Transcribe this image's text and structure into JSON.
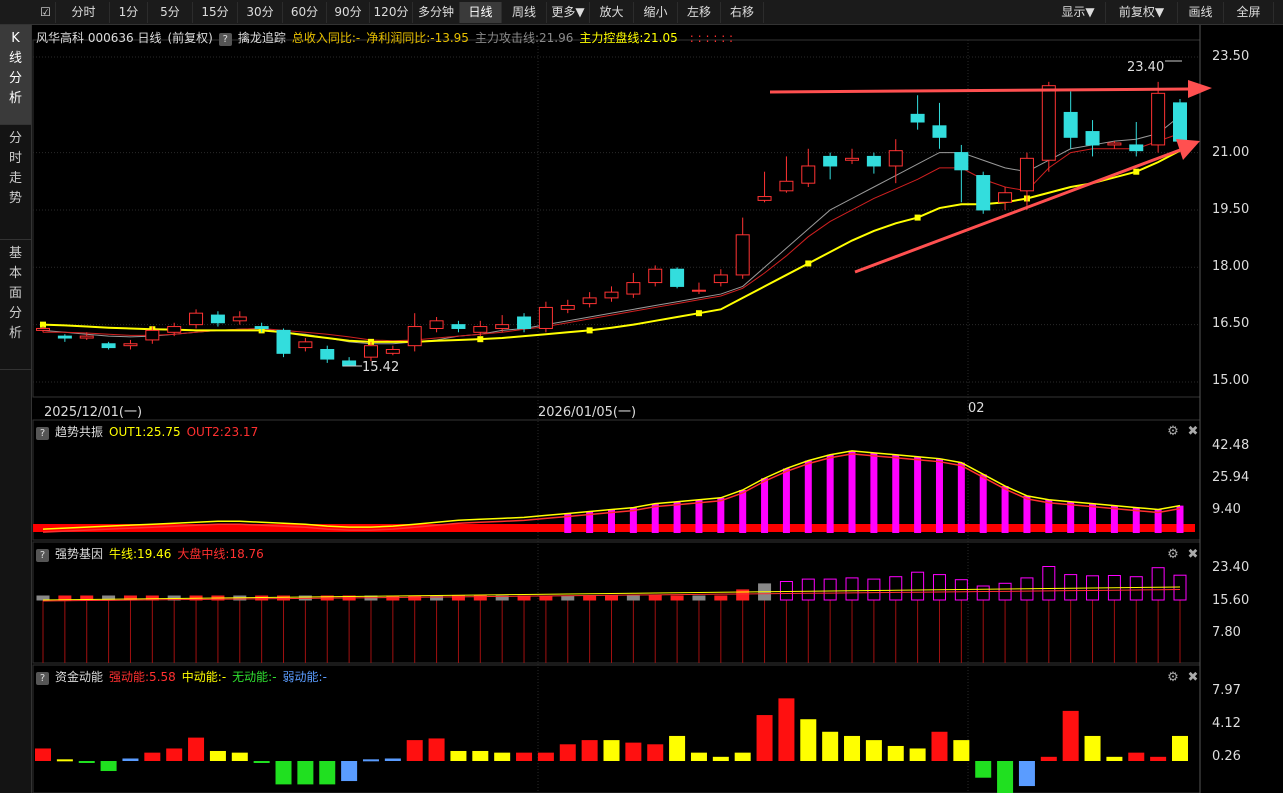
{
  "toolbar": {
    "left": [
      "分时",
      "1分",
      "5分",
      "15分",
      "30分",
      "60分",
      "90分",
      "120分",
      "多分钟",
      "日线",
      "周线",
      "更多▼",
      "放大",
      "缩小",
      "左移",
      "右移"
    ],
    "active": "日线",
    "right": [
      "显示▼",
      "前复权▼",
      "画线",
      "全屏"
    ]
  },
  "sidebar": {
    "tabs": [
      {
        "label": "K线分析",
        "active": true
      },
      {
        "label": "分时走势",
        "active": false
      },
      {
        "label": "基本面分析",
        "active": false
      }
    ]
  },
  "main_panel": {
    "stock_title": "风华高科 000636 日线",
    "adjust": "(前复权)",
    "indicator": "擒龙追踪",
    "items": [
      {
        "text": "总收入同比:-",
        "color": "#e8c000"
      },
      {
        "text": "净利润同比:-13.95",
        "color": "#e8c000"
      },
      {
        "text": "主力攻击线:21.96",
        "color": "#8a8a8a"
      },
      {
        "text": "主力控盘线:21.05",
        "color": "#ffff00"
      }
    ],
    "y_ticks": [
      "23.50",
      "21.00",
      "19.50",
      "18.00",
      "16.50",
      "15.00"
    ],
    "high_label": "23.40",
    "low_label": "15.42",
    "dates": [
      "2025/12/01(一)",
      "2026/01/05(一)",
      "02"
    ]
  },
  "panel2": {
    "title": "趋势共振",
    "items": [
      {
        "text": "OUT1:25.75",
        "color": "#ffff00"
      },
      {
        "text": "OUT2:23.17",
        "color": "#ff3030"
      }
    ],
    "y_ticks": [
      "42.48",
      "25.94",
      "9.40"
    ]
  },
  "panel3": {
    "title": "强势基因",
    "items": [
      {
        "text": "牛线:19.46",
        "color": "#ffff00"
      },
      {
        "text": "大盘中线:18.76",
        "color": "#ff3030"
      }
    ],
    "y_ticks": [
      "23.40",
      "15.60",
      "7.80"
    ]
  },
  "panel4": {
    "title": "资金动能",
    "items": [
      {
        "text": "强动能:5.58",
        "color": "#ff3030"
      },
      {
        "text": "中动能:-",
        "color": "#ffff00"
      },
      {
        "text": "无动能:-",
        "color": "#30e030"
      },
      {
        "text": "弱动能:-",
        "color": "#5a9cff"
      }
    ],
    "y_ticks": [
      "7.97",
      "4.12",
      "0.26"
    ]
  },
  "icons": {
    "settings": "gear-icon",
    "close": "close-icon"
  },
  "chart_data": {
    "type": "candlestick",
    "ylim": [
      15.0,
      23.5
    ],
    "candles": [
      [
        16.35,
        16.4,
        16.3,
        16.45
      ],
      [
        16.2,
        16.15,
        16.05,
        16.25
      ],
      [
        16.15,
        16.2,
        16.1,
        16.3
      ],
      [
        16.0,
        15.9,
        15.85,
        16.05
      ],
      [
        15.95,
        16.0,
        15.85,
        16.1
      ],
      [
        16.1,
        16.35,
        16.0,
        16.45
      ],
      [
        16.3,
        16.45,
        16.2,
        16.55
      ],
      [
        16.5,
        16.8,
        16.4,
        16.9
      ],
      [
        16.75,
        16.55,
        16.45,
        16.85
      ],
      [
        16.6,
        16.7,
        16.5,
        16.85
      ],
      [
        16.45,
        16.4,
        16.3,
        16.55
      ],
      [
        16.35,
        15.75,
        15.65,
        16.4
      ],
      [
        15.9,
        16.05,
        15.8,
        16.15
      ],
      [
        15.85,
        15.6,
        15.5,
        15.95
      ],
      [
        15.55,
        15.42,
        15.42,
        15.65
      ],
      [
        15.65,
        15.95,
        15.55,
        16.05
      ],
      [
        15.75,
        15.85,
        15.7,
        15.95
      ],
      [
        15.95,
        16.45,
        15.8,
        16.8
      ],
      [
        16.4,
        16.6,
        16.3,
        16.7
      ],
      [
        16.5,
        16.4,
        16.3,
        16.6
      ],
      [
        16.3,
        16.45,
        16.2,
        16.6
      ],
      [
        16.4,
        16.5,
        16.3,
        16.75
      ],
      [
        16.7,
        16.4,
        16.3,
        16.8
      ],
      [
        16.4,
        16.95,
        16.3,
        17.1
      ],
      [
        16.9,
        17.0,
        16.8,
        17.15
      ],
      [
        17.05,
        17.2,
        16.95,
        17.35
      ],
      [
        17.2,
        17.35,
        17.1,
        17.5
      ],
      [
        17.3,
        17.6,
        17.2,
        17.85
      ],
      [
        17.6,
        17.95,
        17.5,
        18.05
      ],
      [
        17.95,
        17.5,
        17.45,
        18.0
      ],
      [
        17.4,
        17.4,
        17.3,
        17.6
      ],
      [
        17.6,
        17.8,
        17.5,
        17.95
      ],
      [
        17.8,
        18.85,
        17.7,
        19.3
      ],
      [
        19.75,
        19.85,
        19.7,
        20.5
      ],
      [
        20.0,
        20.25,
        19.95,
        20.9
      ],
      [
        20.2,
        20.65,
        20.1,
        21.1
      ],
      [
        20.9,
        20.65,
        20.3,
        21.0
      ],
      [
        20.8,
        20.85,
        20.7,
        21.1
      ],
      [
        20.9,
        20.65,
        20.45,
        21.0
      ],
      [
        20.65,
        21.05,
        20.2,
        21.35
      ],
      [
        22.0,
        21.8,
        21.6,
        22.5
      ],
      [
        21.7,
        21.4,
        21.1,
        22.3
      ],
      [
        21.0,
        20.55,
        19.7,
        21.2
      ],
      [
        20.4,
        19.5,
        19.4,
        20.5
      ],
      [
        19.7,
        19.95,
        19.5,
        20.1
      ],
      [
        20.0,
        20.85,
        19.5,
        21.0
      ],
      [
        20.8,
        22.75,
        20.5,
        22.85
      ],
      [
        22.05,
        21.4,
        21.1,
        22.6
      ],
      [
        21.55,
        21.2,
        20.9,
        21.85
      ],
      [
        21.2,
        21.25,
        21.1,
        21.3
      ],
      [
        21.2,
        21.05,
        20.9,
        21.8
      ],
      [
        21.2,
        22.55,
        21.0,
        22.85
      ],
      [
        22.3,
        21.3,
        21.2,
        22.4
      ]
    ],
    "ma_gray": [
      16.35,
      16.3,
      16.25,
      16.2,
      16.18,
      16.2,
      16.25,
      16.3,
      16.35,
      16.38,
      16.4,
      16.3,
      16.25,
      16.15,
      16.05,
      16.0,
      16.0,
      16.05,
      16.1,
      16.2,
      16.25,
      16.35,
      16.4,
      16.5,
      16.6,
      16.7,
      16.8,
      16.9,
      17.0,
      17.1,
      17.2,
      17.3,
      17.5,
      18.0,
      18.5,
      19.0,
      19.5,
      19.8,
      20.1,
      20.4,
      20.7,
      21.0,
      21.0,
      20.8,
      20.6,
      20.5,
      20.8,
      21.1,
      21.2,
      21.3,
      21.35,
      21.5,
      21.96
    ],
    "ma_red": [
      16.3,
      16.3,
      16.28,
      16.25,
      16.22,
      16.22,
      16.25,
      16.3,
      16.35,
      16.38,
      16.4,
      16.35,
      16.3,
      16.25,
      16.18,
      16.1,
      16.08,
      16.1,
      16.15,
      16.2,
      16.25,
      16.3,
      16.38,
      16.45,
      16.55,
      16.65,
      16.75,
      16.85,
      16.95,
      17.05,
      17.15,
      17.25,
      17.45,
      17.85,
      18.3,
      18.8,
      19.2,
      19.5,
      19.8,
      20.05,
      20.3,
      20.6,
      20.6,
      20.3,
      20.1,
      20.0,
      20.6,
      21.0,
      21.1,
      21.1,
      21.1,
      21.3,
      21.5
    ],
    "ma_yellow": [
      16.5,
      16.48,
      16.45,
      16.42,
      16.4,
      16.38,
      16.37,
      16.35,
      16.35,
      16.35,
      16.35,
      16.3,
      16.22,
      16.15,
      16.08,
      16.05,
      16.05,
      16.05,
      16.08,
      16.1,
      16.12,
      16.15,
      16.2,
      16.25,
      16.3,
      16.35,
      16.42,
      16.5,
      16.6,
      16.7,
      16.8,
      16.9,
      17.2,
      17.5,
      17.8,
      18.1,
      18.4,
      18.7,
      18.95,
      19.15,
      19.3,
      19.55,
      19.65,
      19.65,
      19.7,
      19.8,
      19.95,
      20.1,
      20.2,
      20.35,
      20.5,
      20.75,
      21.05
    ],
    "trend_osc": [
      2,
      2.5,
      3,
      3.5,
      4,
      4.5,
      5,
      5.5,
      6,
      6,
      5.5,
      5,
      4.5,
      3.5,
      3,
      3,
      3.5,
      4.5,
      5.5,
      6.5,
      7,
      7.5,
      8,
      9,
      10,
      11,
      12,
      13,
      15,
      16,
      17,
      18,
      22,
      28,
      33,
      37,
      40,
      42,
      41,
      40,
      39,
      38,
      36,
      30,
      24,
      19,
      17,
      16,
      15,
      14,
      13,
      12,
      14,
      18
    ],
    "mom_values": [
      1.5,
      0.2,
      -0.2,
      -1.2,
      0.3,
      1.0,
      1.5,
      2.8,
      1.2,
      1.0,
      0.0,
      -2.8,
      -2.8,
      -2.8,
      -2.4,
      0.2,
      0.3,
      2.5,
      2.7,
      1.2,
      1.2,
      1.0,
      1.0,
      1.0,
      2.0,
      2.5,
      2.5,
      2.2,
      2.0,
      3.0,
      1.0,
      0.5,
      1.0,
      5.5,
      7.5,
      5.0,
      3.5,
      3.0,
      2.5,
      1.8,
      1.5,
      3.5,
      2.5,
      -2.0,
      -4.5,
      -3.0,
      0.5,
      6.0,
      3.0,
      0.5,
      1.0,
      0.5,
      3.0,
      0.8,
      5.58
    ],
    "mom_colors": [
      "r",
      "y",
      "g",
      "g",
      "b",
      "r",
      "r",
      "r",
      "y",
      "y",
      "g",
      "g",
      "g",
      "g",
      "b",
      "b",
      "b",
      "r",
      "r",
      "y",
      "y",
      "y",
      "r",
      "r",
      "r",
      "r",
      "y",
      "r",
      "r",
      "y",
      "y",
      "y",
      "y",
      "r",
      "r",
      "y",
      "y",
      "y",
      "y",
      "y",
      "y",
      "r",
      "y",
      "g",
      "g",
      "b",
      "r",
      "r",
      "y",
      "y",
      "r",
      "r",
      "y",
      "y",
      "r"
    ]
  }
}
